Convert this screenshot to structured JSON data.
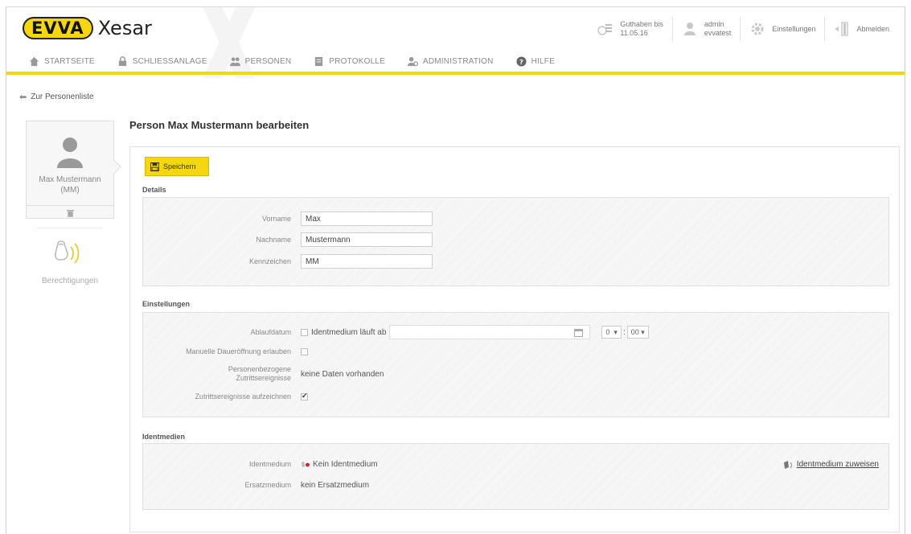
{
  "header": {
    "brand": "EVVA",
    "product": "Xesar",
    "credit_label": "Guthaben bis",
    "credit_date": "11.05.16",
    "user_name": "admin",
    "user_tenant": "evvatest",
    "settings_label": "Einstellungen",
    "logout_label": "Abmelden"
  },
  "nav": {
    "items": [
      {
        "label": "Startseite",
        "icon": "home-icon"
      },
      {
        "label": "Schliessanlage",
        "icon": "lock-icon"
      },
      {
        "label": "Personen",
        "icon": "people-icon"
      },
      {
        "label": "Protokolle",
        "icon": "document-icon"
      },
      {
        "label": "Administration",
        "icon": "admin-icon"
      },
      {
        "label": "Hilfe",
        "icon": "help-icon"
      }
    ]
  },
  "back_link": "Zur Personenliste",
  "person_card": {
    "name": "Max Mustermann",
    "initials": "(MM)"
  },
  "permissions_label": "Berechtigungen",
  "page_title": "Person Max Mustermann bearbeiten",
  "save_label": "Speichern",
  "details": {
    "title": "Details",
    "first_name_label": "Vorname",
    "first_name_value": "Max",
    "last_name_label": "Nachname",
    "last_name_value": "Mustermann",
    "id_label": "Kennzeichen",
    "id_value": "MM"
  },
  "settings": {
    "title": "Einstellungen",
    "expiry_label": "Ablaufdatum",
    "expiry_checkbox_label": "Identmedium läuft ab",
    "hour_value": "0",
    "minute_value": "00",
    "manual_label": "Manuelle Daueröffnung erlauben",
    "events_label_1": "Personenbezogene",
    "events_label_2": "Zutrittsereignisse",
    "events_value": "keine Daten vorhanden",
    "record_label": "Zutrittsereignisse aufzeichnen"
  },
  "media": {
    "title": "Identmedien",
    "medium_label": "Identmedium",
    "medium_value": "Kein Identmedium",
    "assign_label": "Identmedium zuweisen",
    "replacement_label": "Ersatzmedium",
    "replacement_value": "kein Ersatzmedium"
  },
  "colors": {
    "accent": "#f6d60f",
    "panel": "#f5f5f5",
    "alert": "#d0202f"
  }
}
